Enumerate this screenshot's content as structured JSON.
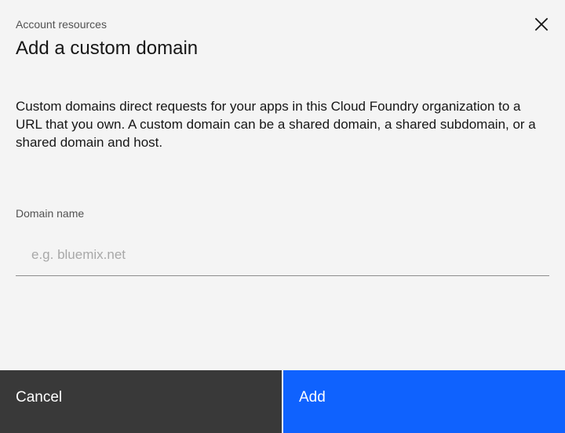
{
  "modal": {
    "label": "Account resources",
    "title": "Add a custom domain",
    "close_label": "Close",
    "description": "Custom domains direct requests for your apps in this Cloud Foundry organization to a URL that you own. A custom domain can be a shared domain, a shared subdomain, or a shared domain and host.",
    "field": {
      "label": "Domain name",
      "value": "",
      "placeholder": "e.g. bluemix.net"
    },
    "buttons": {
      "cancel_label": "Cancel",
      "add_label": "Add"
    },
    "icons": {
      "close": "close-icon"
    },
    "colors": {
      "background": "#f4f4f4",
      "cancel": "#393939",
      "primary": "#0f62fe"
    }
  }
}
